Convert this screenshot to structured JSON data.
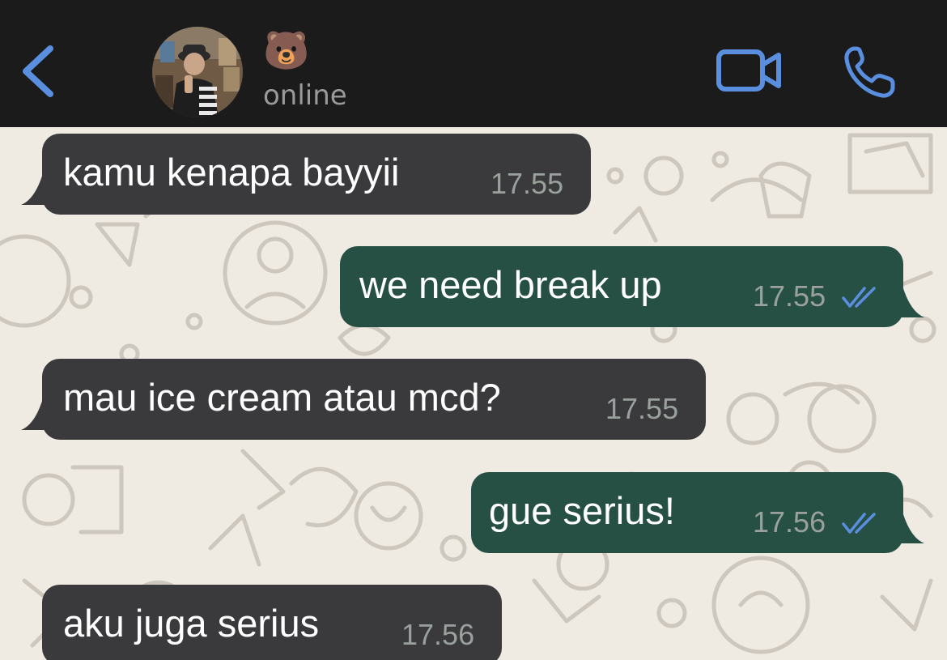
{
  "header": {
    "contact_name": "🐻",
    "status": "online",
    "accent_color": "#5a8fe0"
  },
  "messages": [
    {
      "direction": "incoming",
      "text": "kamu kenapa bayyii",
      "time": "17.55"
    },
    {
      "direction": "outgoing",
      "text": "we need break up",
      "time": "17.55",
      "read": true
    },
    {
      "direction": "incoming",
      "text": "mau ice cream atau mcd?",
      "time": "17.55"
    },
    {
      "direction": "outgoing",
      "text": "gue serius!",
      "time": "17.56",
      "read": true
    },
    {
      "direction": "incoming",
      "text": "aku juga serius",
      "time": "17.56"
    }
  ],
  "colors": {
    "header_bg": "#1b1b1b",
    "chat_bg": "#efeae2",
    "incoming_bubble": "#3a3a3c",
    "outgoing_bubble": "#265044",
    "read_ticks": "#5a8fe0"
  }
}
